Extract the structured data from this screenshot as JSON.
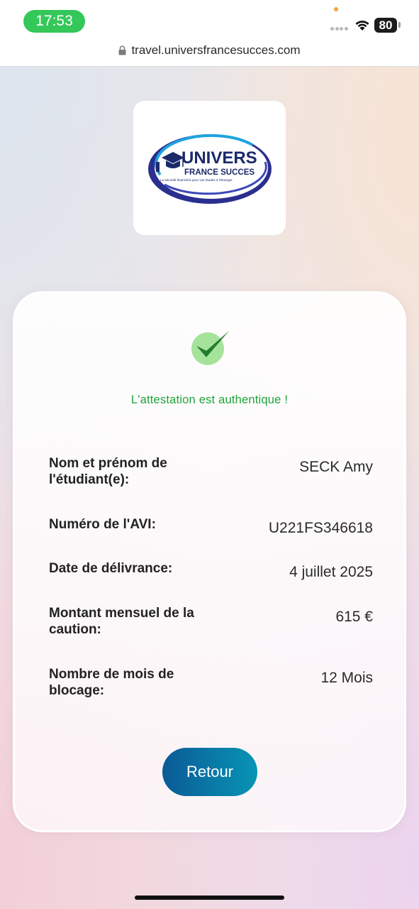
{
  "status_bar": {
    "time": "17:53",
    "battery": "80"
  },
  "browser": {
    "url": "travel.universfrancesucces.com"
  },
  "logo": {
    "line1": "UNIVERS",
    "line2": "FRANCE SUCCES",
    "tagline": "La sécurité financière pour vos études à l'étranger"
  },
  "result": {
    "message": "L'attestation est authentique !",
    "rows": [
      {
        "label": "Nom et prénom de l'étudiant(e):",
        "value": "SECK Amy"
      },
      {
        "label": "Numéro de l'AVI:",
        "value": "U221FS346618"
      },
      {
        "label": "Date de délivrance:",
        "value": "4 juillet 2025"
      },
      {
        "label": "Montant mensuel de la caution:",
        "value": "615 €"
      },
      {
        "label": "Nombre de mois de blocage:",
        "value": "12 Mois"
      }
    ],
    "back_label": "Retour"
  },
  "colors": {
    "success": "#21a23b",
    "button_start": "#0b5a96",
    "button_end": "#0895b5",
    "status_pill": "#34c759"
  }
}
